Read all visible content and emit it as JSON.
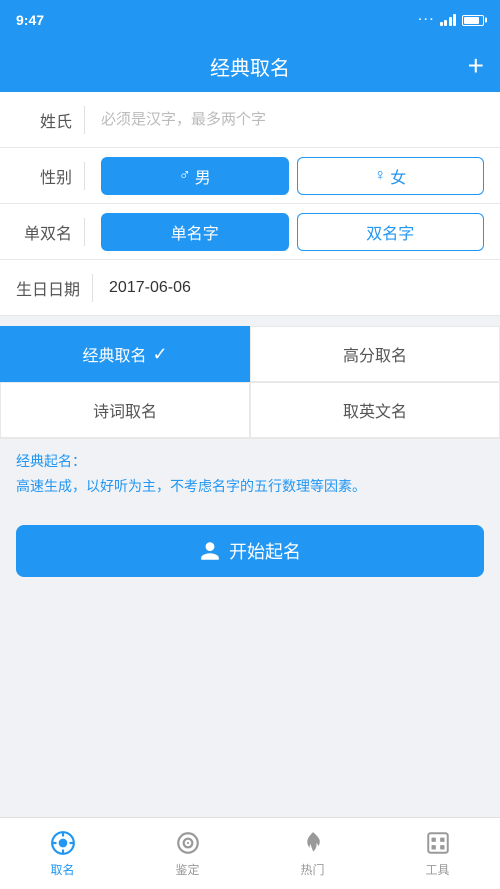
{
  "statusBar": {
    "time": "9:47",
    "signalDots": "..."
  },
  "header": {
    "title": "经典取名",
    "plusLabel": "+"
  },
  "form": {
    "surname": {
      "label": "姓氏",
      "placeholder": "必须是汉字，最多两个字",
      "value": ""
    },
    "gender": {
      "label": "性别",
      "options": [
        {
          "id": "male",
          "icon": "♂",
          "label": "男",
          "active": true
        },
        {
          "id": "female",
          "icon": "♀",
          "label": "女",
          "active": false
        }
      ]
    },
    "nameType": {
      "label": "单双名",
      "options": [
        {
          "id": "single",
          "label": "单名字",
          "active": true
        },
        {
          "id": "double",
          "label": "双名字",
          "active": false
        }
      ]
    },
    "birthday": {
      "label": "生日日期",
      "value": "2017-06-06"
    }
  },
  "nameMethods": {
    "options": [
      {
        "id": "classic",
        "label": "经典取名",
        "active": true,
        "hasCheck": true
      },
      {
        "id": "highscore",
        "label": "高分取名",
        "active": false,
        "hasCheck": false
      },
      {
        "id": "poetry",
        "label": "诗词取名",
        "active": false,
        "hasCheck": false
      },
      {
        "id": "english",
        "label": "取英文名",
        "active": false,
        "hasCheck": false
      }
    ]
  },
  "description": {
    "title": "经典起名：",
    "text": "高速生成，以好听为主，不考虑名字的五行数理等因素。"
  },
  "startButton": {
    "icon": "👤",
    "label": "开始起名"
  },
  "bottomNav": {
    "items": [
      {
        "id": "naming",
        "label": "取名",
        "active": true
      },
      {
        "id": "appraise",
        "label": "鉴定",
        "active": false
      },
      {
        "id": "hot",
        "label": "热门",
        "active": false
      },
      {
        "id": "tools",
        "label": "工具",
        "active": false
      }
    ]
  }
}
